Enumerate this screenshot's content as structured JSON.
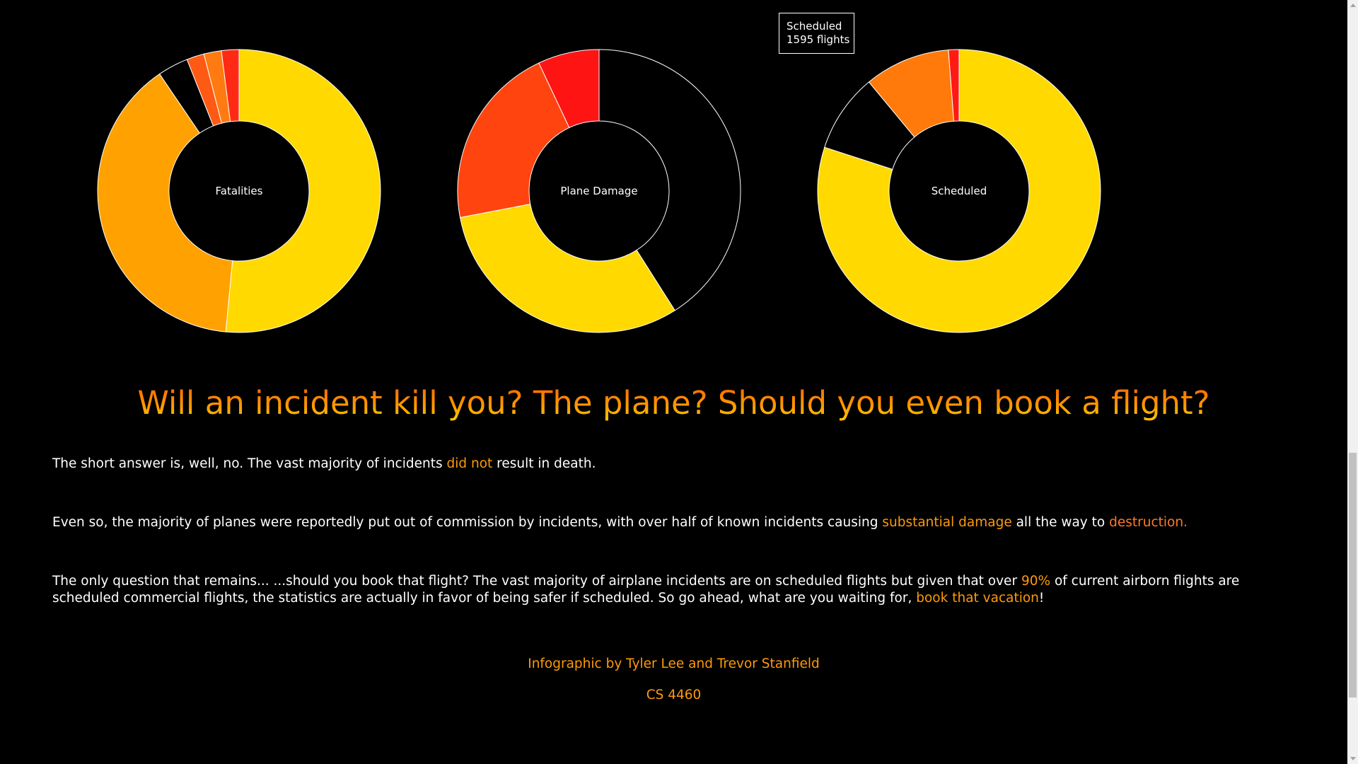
{
  "chart_data": [
    {
      "type": "pie",
      "donut": true,
      "center_label": "Fatalities",
      "slices": [
        {
          "value": 51.5,
          "color": "#ffd900"
        },
        {
          "value": 39.0,
          "color": "#ffa100"
        },
        {
          "value": 3.5,
          "color": "#000000"
        },
        {
          "value": 2.0,
          "color": "#ff5a14"
        },
        {
          "value": 2.0,
          "color": "#ff7a10"
        },
        {
          "value": 2.0,
          "color": "#ff2a14"
        }
      ]
    },
    {
      "type": "pie",
      "donut": true,
      "center_label": "Plane Damage",
      "slices": [
        {
          "value": 41.0,
          "color": "#000000"
        },
        {
          "value": 31.0,
          "color": "#ffd900"
        },
        {
          "value": 21.0,
          "color": "#ff4410"
        },
        {
          "value": 7.0,
          "color": "#ff1414"
        }
      ]
    },
    {
      "type": "pie",
      "donut": true,
      "center_label": "Scheduled",
      "slices": [
        {
          "value": 80.0,
          "color": "#ffd900"
        },
        {
          "value": 9.0,
          "color": "#000000"
        },
        {
          "value": 9.8,
          "color": "#ff7a0a"
        },
        {
          "value": 1.2,
          "color": "#ff1a14"
        }
      ]
    }
  ],
  "tooltip": {
    "line1": "Scheduled",
    "line2": "1595 flights"
  },
  "headline": "Will an incident kill you? The plane? Should you even book a flight?",
  "paragraphs": {
    "p1": {
      "before": "The short answer is, well, no. The vast majority of incidents ",
      "highlight": "did not",
      "after": " result in death."
    },
    "p2": {
      "before": "Even so, the majority of planes were reportedly put out of commission by incidents, with over half of known incidents causing ",
      "highlight1": "substantial damage",
      "middle": " all the way to ",
      "highlight2": "destruction."
    },
    "p3": {
      "before": "The only question that remains... ...should you book that flight? The vast majority of airplane incidents are on scheduled flights but given that over ",
      "highlight1": "90%",
      "middle": " of current airborn flights are scheduled commercial flights, the statistics are actually in favor of being safer if scheduled. So go ahead, what are you waiting for, ",
      "highlight2": "book that vacation",
      "after": "!"
    }
  },
  "credits": {
    "authors": "Infographic by Tyler Lee and Trevor Stanfield",
    "course": "CS 4460"
  },
  "colors": {
    "accent": "#ff9a0a",
    "background": "#000000",
    "text": "#ffffff"
  }
}
